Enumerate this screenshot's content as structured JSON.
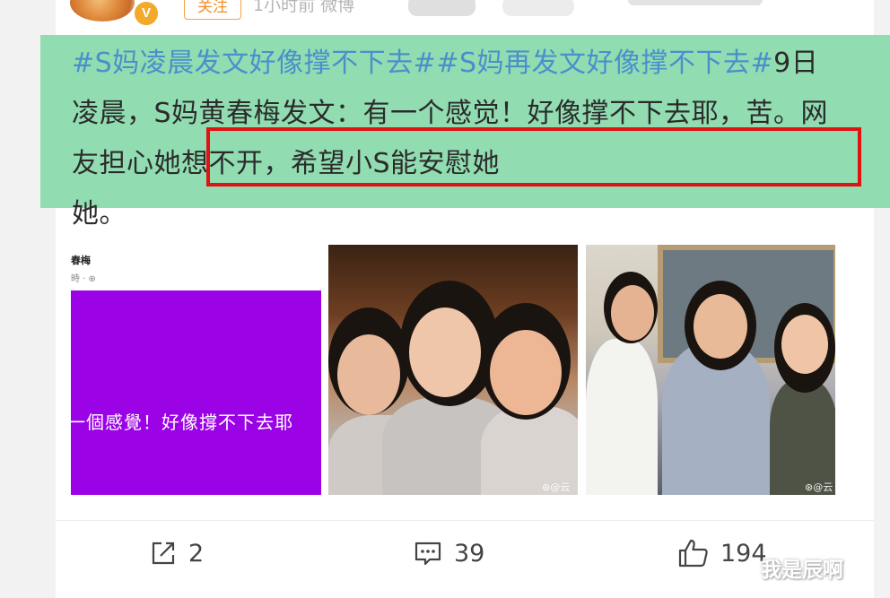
{
  "header": {
    "badge": "V",
    "follow_label": "关注",
    "time_source": "1小时前  微博"
  },
  "post": {
    "topic": "#S妈凌晨发文好像撑不下去##S妈再发文好像撑不下去#",
    "body_before": "9日凌晨，S妈黄春梅发文：有一个感觉！好像撑不下去耶",
    "body_highlight": "，苦。网友担心她想不开，希望小S能安慰她",
    "body_end": "她。"
  },
  "images": {
    "first_name": "春梅",
    "first_sub": "時 · ⊕",
    "first_caption": "一個感覺！好像撐不下去耶",
    "watermark2": "⊛@云",
    "watermark3": "⊛@云"
  },
  "actions": {
    "share_count": "2",
    "comment_count": "39",
    "like_count": "194"
  },
  "watermark": "我是辰啊",
  "colors": {
    "highlight": "#91ddb1",
    "topic": "#4a8fcc",
    "redbox": "#e01212",
    "purple": "#9b02e6",
    "follow": "#f08f2c"
  }
}
